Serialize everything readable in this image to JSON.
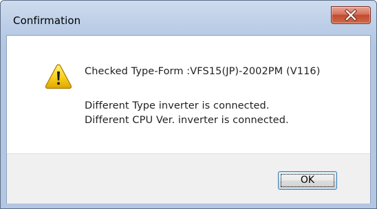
{
  "window": {
    "title": "Confirmation"
  },
  "dialog": {
    "icon": "warning-icon",
    "message": "Checked Type-Form :VFS15(JP)-2002PM (V116)",
    "details": [
      "Different Type inverter is connected.",
      "Different CPU Ver. inverter is connected."
    ]
  },
  "buttons": {
    "ok_label": "OK",
    "close_icon": "close-icon"
  },
  "colors": {
    "title_bar": "#bfd0e8",
    "close_button": "#c24a2f",
    "warning_yellow": "#f5c400",
    "button_area": "#f0f0f0",
    "focus_border": "#3c7fb1"
  }
}
